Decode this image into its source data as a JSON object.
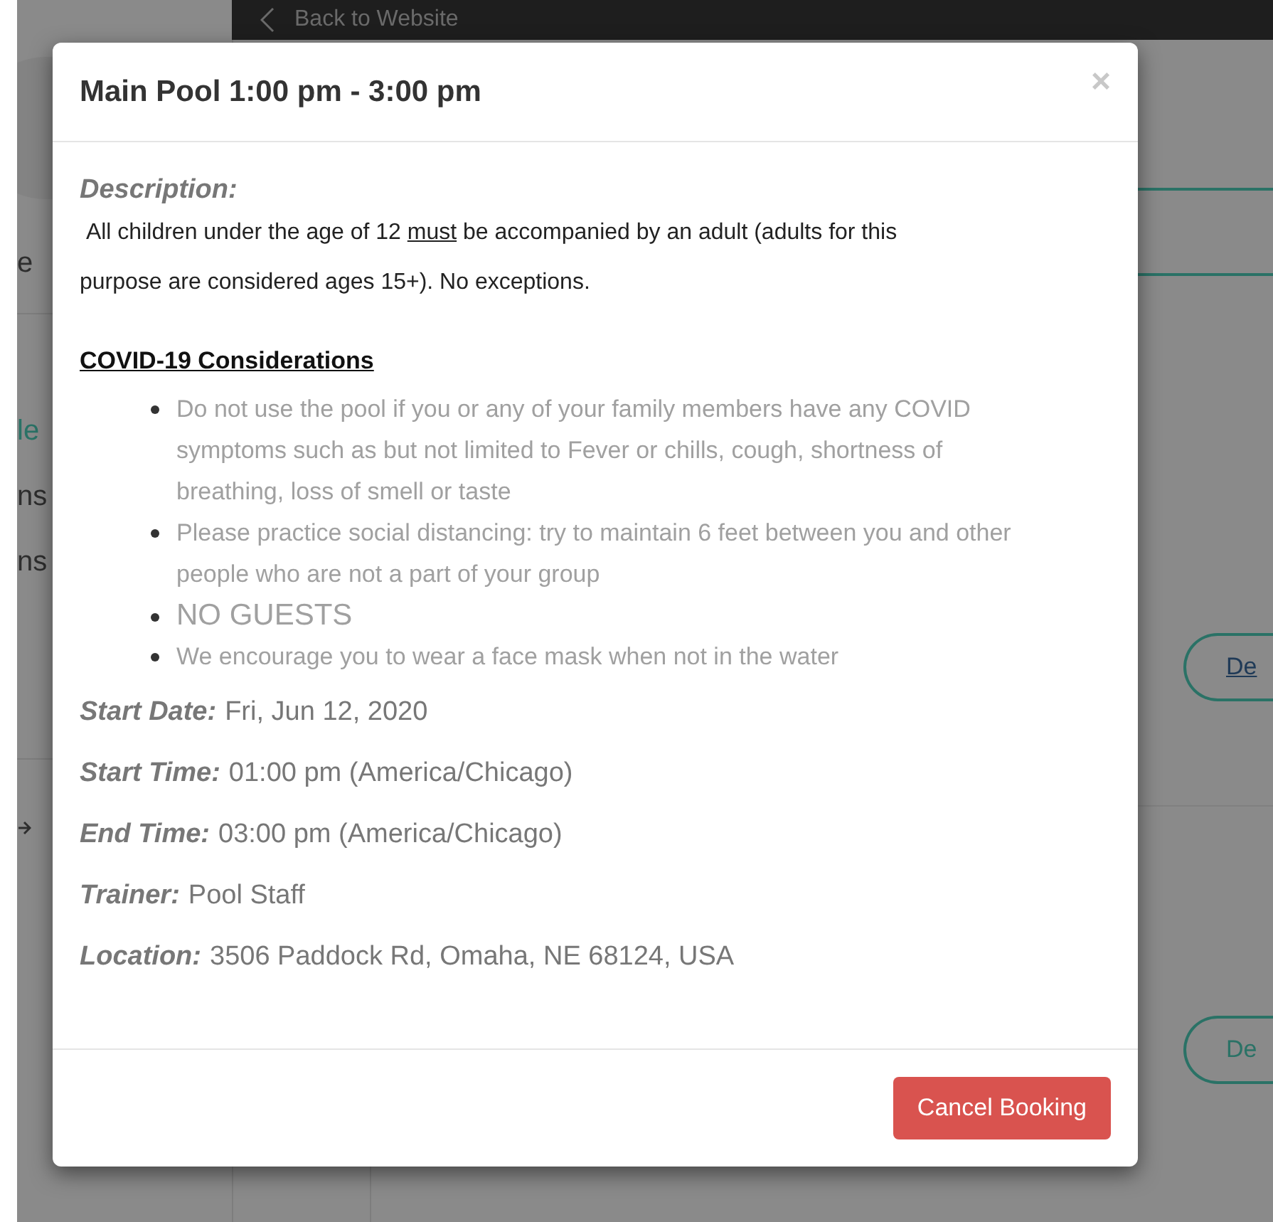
{
  "background": {
    "top_bar": {
      "back_link": "Back to Website"
    },
    "sidebar_items": [
      {
        "label": "e",
        "selected": false
      },
      {
        "label": "le",
        "selected": true
      },
      {
        "label": "ns",
        "selected": false
      },
      {
        "label": "ns",
        "selected": false
      }
    ],
    "buttons": [
      {
        "label": "De",
        "hovered": true
      },
      {
        "label": "De",
        "hovered": false
      }
    ]
  },
  "modal": {
    "title": "Main Pool 1:00 pm - 3:00 pm",
    "close": "×",
    "description_label": "Description:",
    "description": [
      {
        "text": " All children under the age of 12 ",
        "underline": false
      },
      {
        "text": "must",
        "underline": true
      },
      {
        "text": " be accompanied by an adult (adults for this purpose are considered ages 15+). No exceptions.",
        "underline": false
      }
    ],
    "covid_heading": "COVID-19 Considerations",
    "covid_items": [
      {
        "text": "Do not use the pool if you or any of your family members have any COVID symptoms such as but not limited to Fever or chills, cough, shortness of breathing, loss of smell or taste",
        "kind": "normal"
      },
      {
        "text": "Please practice social distancing: try to maintain 6 feet between you and other people who are not a part of your group",
        "kind": "normal"
      },
      {
        "text": "NO GUESTS",
        "kind": "large"
      },
      {
        "text": "We encourage you to wear a face mask when not in the water",
        "kind": "normal"
      }
    ],
    "details": [
      {
        "label": "Start Date:",
        "value": "Fri, Jun 12, 2020"
      },
      {
        "label": "Start Time:",
        "value": "01:00 pm (America/Chicago)"
      },
      {
        "label": "End Time:",
        "value": "03:00 pm (America/Chicago)"
      },
      {
        "label": "Trainer:",
        "value": "Pool Staff"
      },
      {
        "label": "Location:",
        "value": "3506 Paddock Rd, Omaha, NE 68124, USA"
      }
    ],
    "button": "Cancel Booking"
  }
}
